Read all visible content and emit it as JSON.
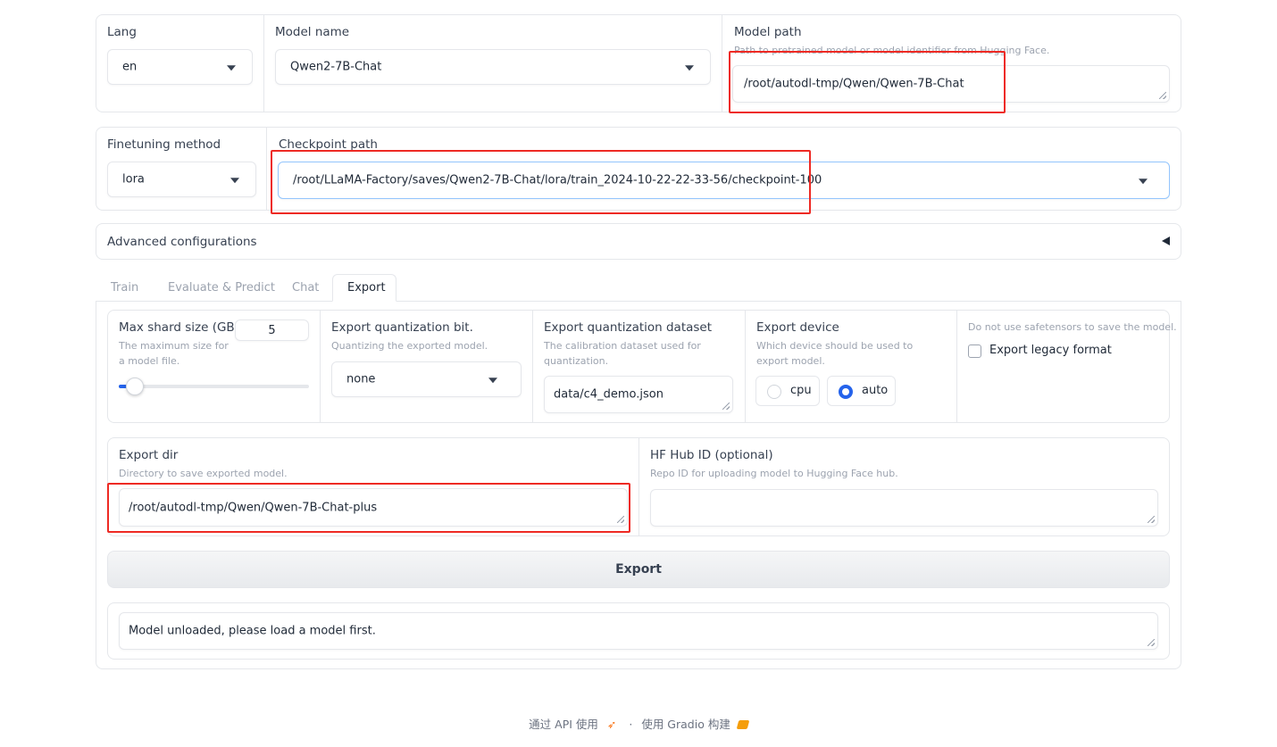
{
  "top_row": {
    "lang": {
      "label": "Lang",
      "value": "en"
    },
    "model_name": {
      "label": "Model name",
      "value": "Qwen2-7B-Chat"
    },
    "model_path": {
      "label": "Model path",
      "info": "Path to pretrained model or model identifier from Hugging Face.",
      "value": "/root/autodl-tmp/Qwen/Qwen-7B-Chat"
    }
  },
  "second_row": {
    "finetuning_method": {
      "label": "Finetuning method",
      "value": "lora"
    },
    "checkpoint_path": {
      "label": "Checkpoint path",
      "value": "/root/LLaMA-Factory/saves/Qwen2-7B-Chat/lora/train_2024-10-22-22-33-56/checkpoint-100"
    }
  },
  "advanced": {
    "label": "Advanced configurations",
    "icon": "triangle-left-icon"
  },
  "tabs": [
    {
      "label": "Train",
      "active": false
    },
    {
      "label": "Evaluate & Predict",
      "active": false
    },
    {
      "label": "Chat",
      "active": false
    },
    {
      "label": "Export",
      "active": true
    }
  ],
  "export": {
    "max_shard": {
      "label": "Max shard size (GB)",
      "info": "The maximum size for a model file.",
      "value": "5",
      "min": 1,
      "max": 100
    },
    "quant_bit": {
      "label": "Export quantization bit.",
      "info": "Quantizing the exported model.",
      "value": "none"
    },
    "quant_dataset": {
      "label": "Export quantization dataset",
      "info": "The calibration dataset used for quantization.",
      "value": "data/c4_demo.json"
    },
    "device": {
      "label": "Export device",
      "info": "Which device should be used to export model.",
      "options": [
        {
          "label": "cpu",
          "selected": false
        },
        {
          "label": "auto",
          "selected": true
        }
      ]
    },
    "legacy": {
      "info": "Do not use safetensors to save the model.",
      "label": "Export legacy format",
      "checked": false
    },
    "export_dir": {
      "label": "Export dir",
      "info": "Directory to save exported model.",
      "value": "/root/autodl-tmp/Qwen/Qwen-7B-Chat-plus"
    },
    "hub_id": {
      "label": "HF Hub ID (optional)",
      "info": "Repo ID for uploading model to Hugging Face hub.",
      "value": ""
    },
    "button": "Export",
    "output": "Model unloaded, please load a model first."
  },
  "footer": {
    "api": "通过 API 使用",
    "sep": "·",
    "built": "使用 Gradio 构建"
  },
  "colors": {
    "accent": "#2563eb",
    "highlight": "#ee2a24",
    "border": "#e5e7eb"
  }
}
